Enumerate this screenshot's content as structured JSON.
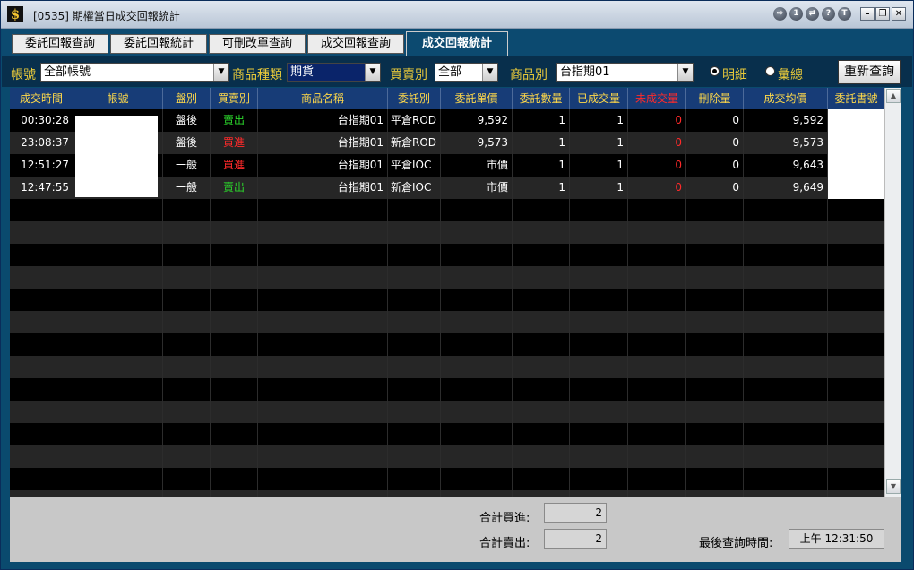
{
  "window": {
    "title": "[0535] 期權當日成交回報統計",
    "app_icon": "$",
    "controls": [
      "tool-icon",
      "info-icon",
      "share-icon",
      "help-icon",
      "t-icon"
    ],
    "control_glyphs": [
      "⇨",
      "1",
      "⇄",
      "?",
      "T"
    ]
  },
  "tabs": [
    {
      "label": "委託回報查詢",
      "active": false
    },
    {
      "label": "委託回報統計",
      "active": false
    },
    {
      "label": "可刪改單查詢",
      "active": false
    },
    {
      "label": "成交回報查詢",
      "active": false
    },
    {
      "label": "成交回報統計",
      "active": true
    }
  ],
  "filters": {
    "account_label": "帳號",
    "account_value": "全部帳號",
    "product_type_label": "商品種類",
    "product_type_value": "期貨",
    "side_label": "買賣別",
    "side_value": "全部",
    "product_label": "商品別",
    "product_value": "台指期01",
    "radio_detail": "明細",
    "radio_summary": "彙總",
    "selected_radio": "detail",
    "requery_label": "重新查詢"
  },
  "table": {
    "columns": [
      "成交時間",
      "帳號",
      "盤別",
      "買賣別",
      "商品名稱",
      "委託別",
      "委託單價",
      "委託數量",
      "已成交量",
      "未成交量",
      "刪除量",
      "成交均價",
      "委託書號"
    ],
    "rows": [
      {
        "time": "00:30:28",
        "account": "",
        "session": "盤後",
        "side": "賣出",
        "product": "台指期01",
        "order_type": "平倉ROD",
        "price": "9,592",
        "qty": "1",
        "filled": "1",
        "unfilled": "0",
        "deleted": "0",
        "avg_price": "9,592",
        "order_no": ""
      },
      {
        "time": "23:08:37",
        "account": "",
        "session": "盤後",
        "side": "買進",
        "product": "台指期01",
        "order_type": "新倉ROD",
        "price": "9,573",
        "qty": "1",
        "filled": "1",
        "unfilled": "0",
        "deleted": "0",
        "avg_price": "9,573",
        "order_no": ""
      },
      {
        "time": "12:51:27",
        "account": "",
        "session": "一般",
        "side": "買進",
        "product": "台指期01",
        "order_type": "平倉IOC",
        "price": "市價",
        "qty": "1",
        "filled": "1",
        "unfilled": "0",
        "deleted": "0",
        "avg_price": "9,643",
        "order_no": ""
      },
      {
        "time": "12:47:55",
        "account": "",
        "session": "一般",
        "side": "賣出",
        "product": "台指期01",
        "order_type": "新倉IOC",
        "price": "市價",
        "qty": "1",
        "filled": "1",
        "unfilled": "0",
        "deleted": "0",
        "avg_price": "9,649",
        "order_no": ""
      }
    ]
  },
  "colors": {
    "buy": "#ff2a2a",
    "sell": "#2bd52b",
    "header_text": "#ffd94a",
    "unfilled_header": "#ff2a2a"
  },
  "footer": {
    "total_buy_label": "合計買進:",
    "total_buy_value": "2",
    "total_sell_label": "合計賣出:",
    "total_sell_value": "2",
    "last_query_label": "最後查詢時間:",
    "last_query_value": "上午 12:31:50"
  }
}
